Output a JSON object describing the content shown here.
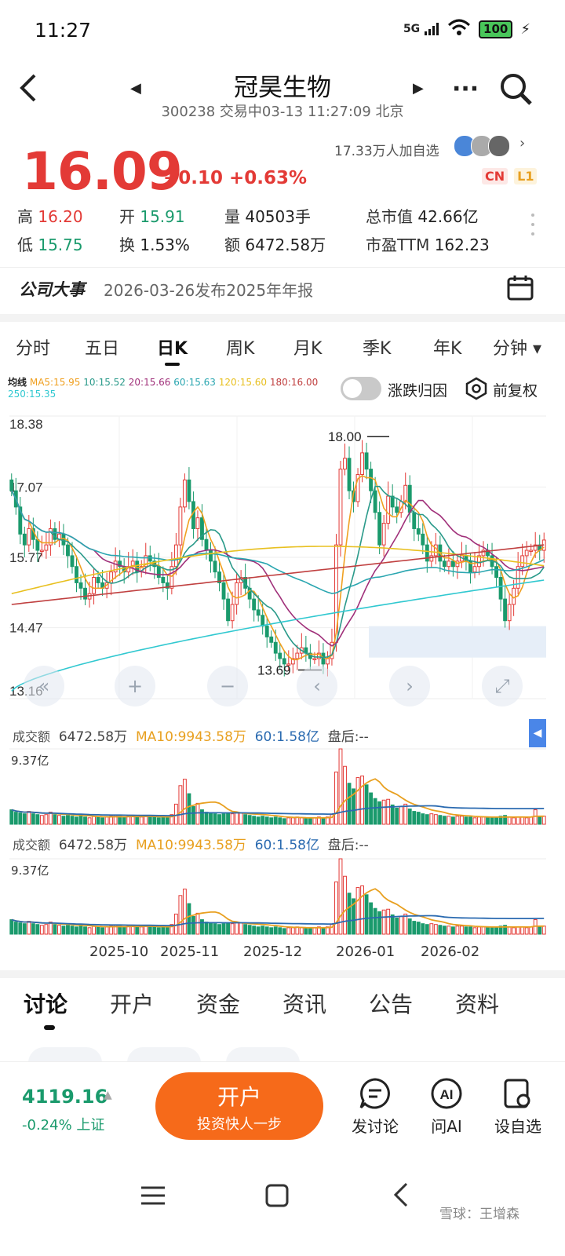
{
  "status_bar": {
    "time": "11:27",
    "network": "5G",
    "battery": "100"
  },
  "header": {
    "title": "冠昊生物",
    "subtitle": "300238 交易中03-13 11:27:09 北京"
  },
  "quote": {
    "price": "16.09",
    "change": "+0.10 +0.63%",
    "followers": "17.33万人加自选",
    "tag_cn": "CN",
    "tag_l1": "L1",
    "high_label": "高",
    "high": "16.20",
    "low_label": "低",
    "low": "15.75",
    "open_label": "开",
    "open": "15.91",
    "turnover_label": "换",
    "turnover": "1.53%",
    "volume_label": "量",
    "volume": "40503手",
    "amount_label": "额",
    "amount": "6472.58万",
    "mcap_label": "总市值",
    "mcap": "42.66亿",
    "pe_label": "市盈TTM",
    "pe": "162.23"
  },
  "event": {
    "label": "公司大事",
    "text": "2026-03-26发布2025年年报"
  },
  "chart_tabs": [
    "分时",
    "五日",
    "日K",
    "周K",
    "月K",
    "季K",
    "年K",
    "分钟 ▾"
  ],
  "chart_tabs_active": "日K",
  "ma_legend": {
    "title": "均线",
    "ma5": "MA5:15.95",
    "ma10": "10:15.52",
    "ma20": "20:15.66",
    "ma60": "60:15.63",
    "ma120": "120:15.60",
    "ma180": "180:16.00",
    "ma250": "250:15.35"
  },
  "toggle_label": "涨跌归因",
  "fuquan_label": "前复权",
  "colors": {
    "up": "#e33a36",
    "down": "#1a9a6c",
    "ma5": "#f0a020",
    "ma10": "#2a9a8a",
    "ma20": "#a0307a",
    "ma60": "#2aa6b0",
    "ma120": "#e8c020",
    "ma180": "#c04040",
    "ma250": "#30c8d0",
    "accent": "#f66a1a"
  },
  "chart_data": {
    "type": "candlestick",
    "y_ticks": [
      "18.38",
      "17.07",
      "15.77",
      "14.47",
      "13.16"
    ],
    "ylim": [
      13.16,
      18.38
    ],
    "annotations": {
      "high": "18.00",
      "low": "13.69"
    },
    "x_ticks": [
      "2025-10",
      "2025-11",
      "2025-12",
      "2026-01",
      "2026-02"
    ],
    "closes": [
      17.0,
      16.7,
      16.2,
      16.0,
      16.3,
      16.1,
      15.9,
      15.9,
      16.0,
      16.3,
      16.1,
      16.2,
      16.0,
      15.8,
      15.6,
      15.3,
      15.2,
      15.0,
      15.1,
      15.4,
      15.3,
      15.2,
      15.3,
      15.5,
      15.7,
      15.6,
      15.5,
      15.6,
      15.7,
      15.5,
      15.6,
      15.8,
      15.7,
      15.6,
      15.4,
      15.3,
      15.2,
      15.6,
      16.0,
      16.7,
      17.2,
      16.8,
      16.3,
      16.5,
      16.1,
      15.9,
      15.7,
      15.5,
      15.3,
      15.0,
      14.6,
      14.9,
      15.3,
      15.4,
      15.2,
      15.0,
      14.8,
      14.7,
      14.5,
      14.3,
      14.2,
      14.0,
      13.9,
      13.8,
      13.8,
      13.9,
      14.0,
      14.1,
      14.0,
      13.9,
      13.9,
      14.0,
      13.8,
      13.9,
      14.2,
      16.0,
      17.4,
      17.6,
      17.0,
      16.8,
      17.3,
      17.7,
      17.4,
      17.0,
      16.6,
      16.0,
      16.4,
      16.9,
      16.7,
      16.6,
      16.8,
      17.1,
      16.6,
      16.3,
      16.2,
      16.0,
      15.7,
      15.8,
      16.0,
      15.7,
      15.6,
      15.7,
      15.6,
      15.7,
      15.8,
      15.7,
      15.5,
      15.6,
      15.8,
      15.9,
      15.8,
      15.6,
      15.4,
      15.0,
      14.6,
      14.9,
      15.2,
      15.6,
      15.8,
      15.9,
      15.9,
      16.0,
      15.9,
      16.09
    ],
    "volume": {
      "legend_label": "成交额",
      "value": "6472.58万",
      "ma10": "MA10:9943.58万",
      "ma60": "60:1.58亿",
      "after": "盘后:--",
      "ymax_label": "9.37亿"
    },
    "volume_bars": [
      1.8,
      1.5,
      1.4,
      1.3,
      1.6,
      1.3,
      1.2,
      1.1,
      1.2,
      1.5,
      1.2,
      1.1,
      1.0,
      1.1,
      1.0,
      0.9,
      1.0,
      0.9,
      0.8,
      1.0,
      0.9,
      0.8,
      0.9,
      1.0,
      1.1,
      1.0,
      0.9,
      1.0,
      1.1,
      0.9,
      0.9,
      1.0,
      0.9,
      0.9,
      0.8,
      0.9,
      0.8,
      1.2,
      2.5,
      4.8,
      5.6,
      3.8,
      2.2,
      2.6,
      1.8,
      1.5,
      1.4,
      1.3,
      1.2,
      1.3,
      1.4,
      1.3,
      1.5,
      1.4,
      1.2,
      1.1,
      1.0,
      0.9,
      1.0,
      0.9,
      0.8,
      0.9,
      0.8,
      0.7,
      0.8,
      0.8,
      0.9,
      0.8,
      0.7,
      0.8,
      0.8,
      0.9,
      0.8,
      0.9,
      1.2,
      6.5,
      9.37,
      7.2,
      5.1,
      4.4,
      5.8,
      6.0,
      4.9,
      3.9,
      3.2,
      2.8,
      3.0,
      3.1,
      2.4,
      2.0,
      2.2,
      2.5,
      1.9,
      1.6,
      1.5,
      1.3,
      1.2,
      1.3,
      1.2,
      1.1,
      1.0,
      1.0,
      0.9,
      1.0,
      1.0,
      0.9,
      0.9,
      0.8,
      0.9,
      0.9,
      0.8,
      0.8,
      0.9,
      1.0,
      1.1,
      0.9,
      0.8,
      0.9,
      0.9,
      0.8,
      0.9,
      1.8,
      0.9,
      1.0
    ]
  },
  "bottom_tabs": [
    "讨论",
    "开户",
    "资金",
    "资讯",
    "公告",
    "资料"
  ],
  "index": {
    "value": "4119.16",
    "change": "-0.24% 上证"
  },
  "open_account": {
    "title": "开户",
    "subtitle": "投资快人一步"
  },
  "actions": [
    "发讨论",
    "问AI",
    "设自选"
  ],
  "watermark": "雪球：王增森"
}
